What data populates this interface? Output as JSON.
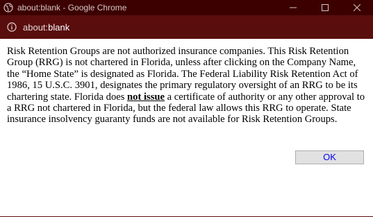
{
  "window": {
    "title": "about:blank - Google Chrome",
    "controls": [
      "minimize-icon",
      "maximize-icon",
      "close-icon"
    ],
    "title_icon": "globe-icon",
    "colors": {
      "titlebar": "#3c0000",
      "addressbar": "#5a0d0d"
    }
  },
  "address_bar": {
    "info_icon": "info-icon",
    "scheme": "about:",
    "host": "blank"
  },
  "dialog": {
    "message_part1": "Risk Retention Groups are not authorized insurance companies. This Risk Retention Group (RRG) is not chartered in Florida, unless after clicking on the Company Name, the “Home State” is designated as Florida. The Federal Liability Risk Retention Act of 1986, 15 U.S.C. 3901, designates the primary regulatory oversight of an RRG to be its chartering state. Florida does ",
    "message_emphasis": "not issue",
    "message_part2": " a certificate of authority or any other approval to a RRG not chartered in Florida, but the federal law allows this RRG to operate. State insurance insolvency guaranty funds are not available for Risk Retention Groups.",
    "ok_label": "OK"
  }
}
